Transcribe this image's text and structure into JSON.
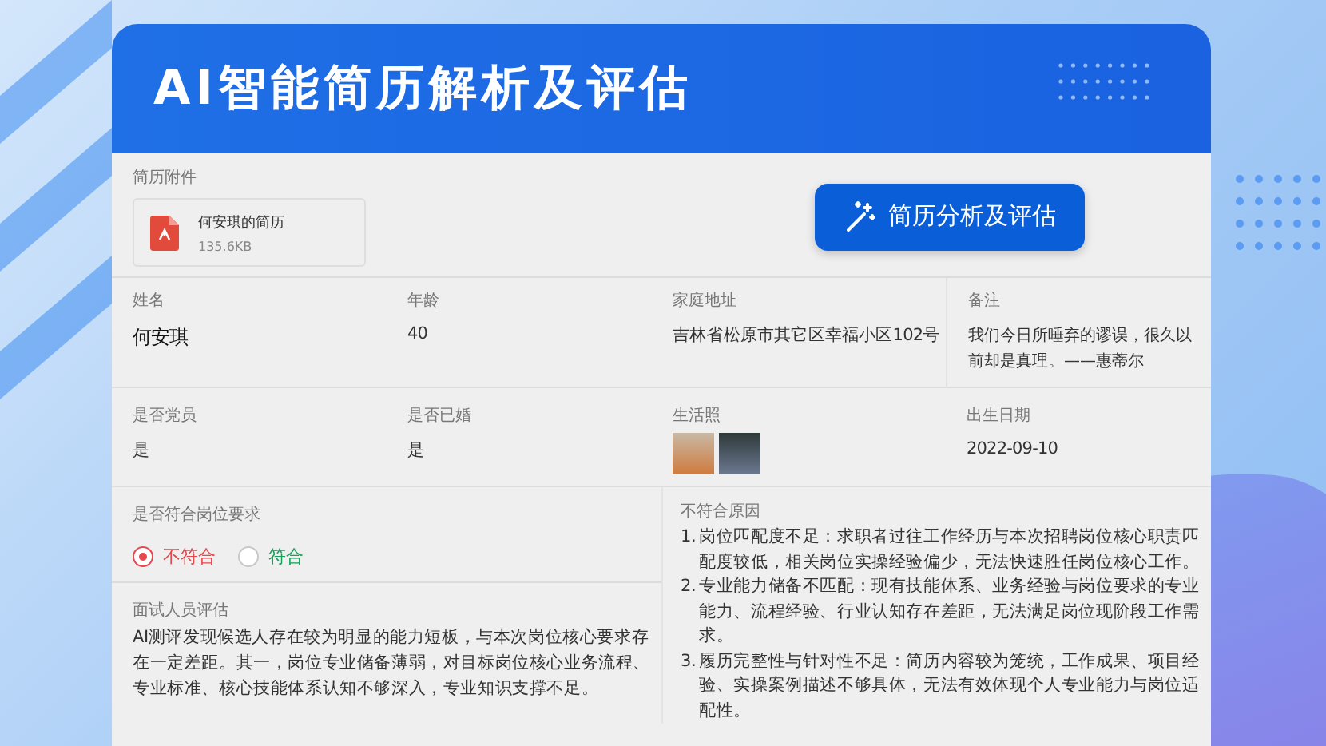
{
  "header": {
    "title": "AI智能简历解析及评估"
  },
  "attachment": {
    "label": "简历附件",
    "file": {
      "name": "何安琪的简历",
      "size": "135.6KB"
    }
  },
  "analyze_button": {
    "label": "简历分析及评估"
  },
  "fields": [
    {
      "label": "姓名",
      "kind": "name",
      "value": "何安琪"
    },
    {
      "label": "年龄",
      "kind": "text",
      "value": "40"
    },
    {
      "label": "家庭地址",
      "kind": "text",
      "value": "吉林省松原市其它区幸福小区102号"
    },
    {
      "label": "备注",
      "kind": "note",
      "value": "我们今日所唾弃的谬误，很久以前却是真理。——惠蒂尔"
    },
    {
      "label": "是否党员",
      "kind": "text",
      "value": "是"
    },
    {
      "label": "是否已婚",
      "kind": "text",
      "value": "是"
    },
    {
      "label": "生活照",
      "kind": "photos",
      "photos": [
        {
          "kind": "portrait"
        },
        {
          "kind": "portrait"
        }
      ]
    },
    {
      "label": "出生日期",
      "kind": "text",
      "value": "2022-09-10"
    }
  ],
  "fit": {
    "label": "是否符合岗位要求",
    "options": [
      {
        "label": "不符合",
        "selected": true,
        "color": "#e5484d"
      },
      {
        "label": "符合",
        "selected": false,
        "color": "#18a058"
      }
    ]
  },
  "evaluation": {
    "label": "面试人员评估",
    "text": "AI测评发现候选人存在较为明显的能力短板，与本次岗位核心要求存在一定差距。其一，岗位专业储备薄弱，对目标岗位核心业务流程、专业标准、核心技能体系认知不够深入，专业知识支撑不足。"
  },
  "reasons": {
    "label": "不符合原因",
    "items": [
      {
        "number": "1.",
        "text": "岗位匹配度不足：求职者过往工作经历与本次招聘岗位核心职责匹配度较低，相关岗位实操经验偏少，无法快速胜任岗位核心工作。"
      },
      {
        "number": "2.",
        "text": "专业能力储备不匹配：现有技能体系、业务经验与岗位要求的专业能力、流程经验、行业认知存在差距，无法满足岗位现阶段工作需求。"
      },
      {
        "number": "3.",
        "text": "履历完整性与针对性不足：简历内容较为笼统，工作成果、项目经验、实操案例描述不够具体，无法有效体现个人专业能力与岗位适配性。"
      }
    ]
  }
}
